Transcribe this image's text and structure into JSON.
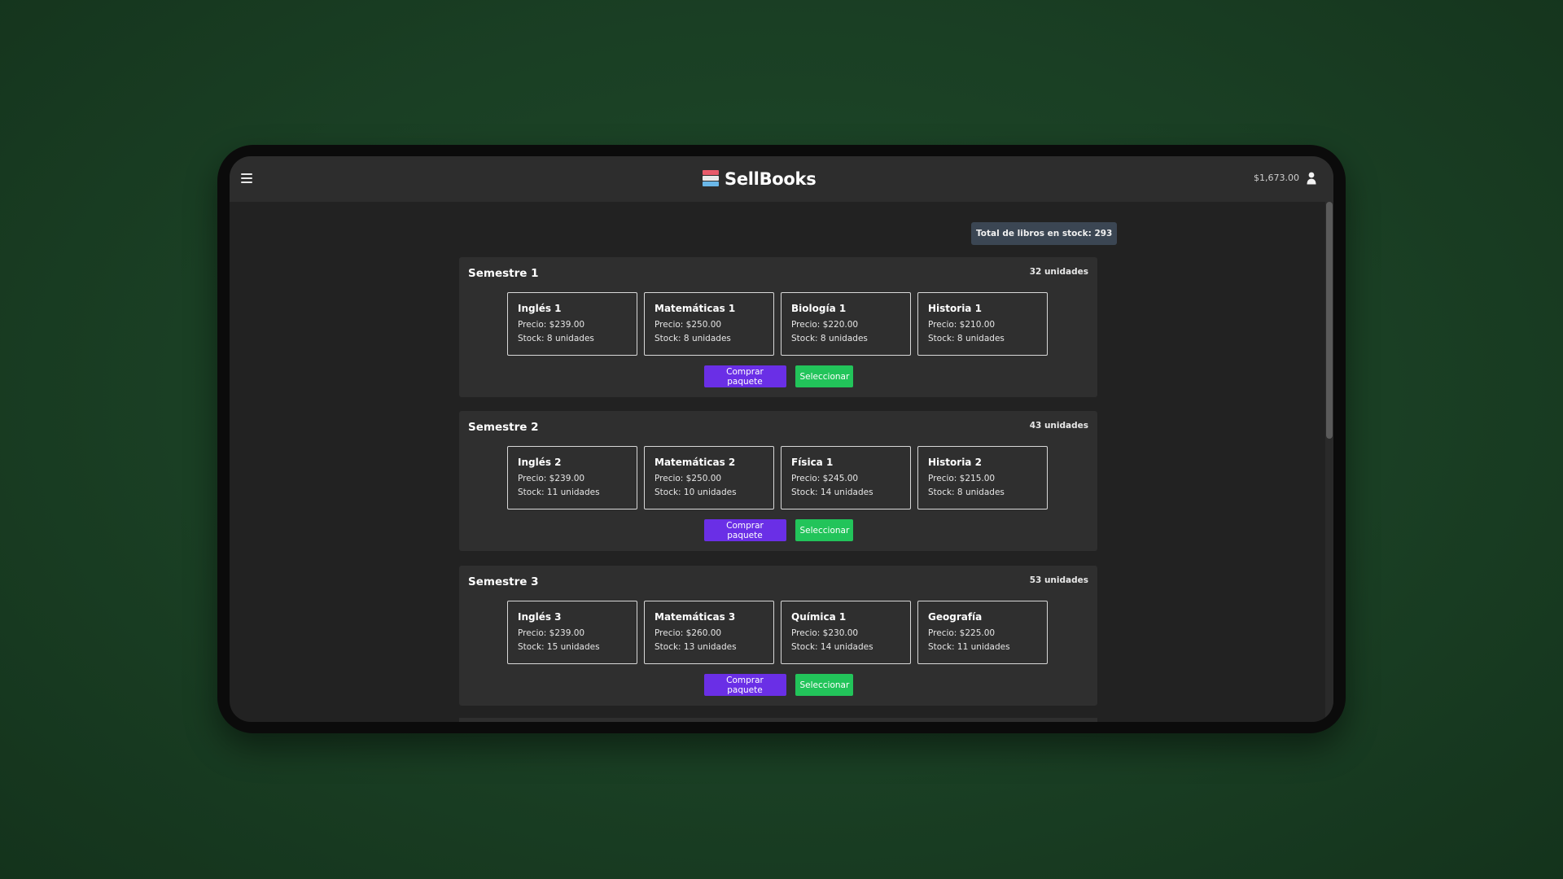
{
  "header": {
    "app_name": "SellBooks",
    "balance": "$1,673.00",
    "menu_icon": "hamburger-menu-icon",
    "logo_icon": "books-stack-icon",
    "user_icon": "user-icon"
  },
  "colors": {
    "background": "#1a3f24",
    "screen": "#222222",
    "topbar": "#2d2d2d",
    "card": "#2f2f2f",
    "badge": "#3b4653",
    "buy_button": "#6a2fe6",
    "select_button": "#22c45a"
  },
  "total_stock_label": "Total de libros en stock: 293",
  "semesters": [
    {
      "title": "Semestre 1",
      "units": "32 unidades",
      "books": [
        {
          "title": "Inglés 1",
          "price": "Precio: $239.00",
          "stock": "Stock: 8 unidades"
        },
        {
          "title": "Matemáticas 1",
          "price": "Precio: $250.00",
          "stock": "Stock: 8 unidades"
        },
        {
          "title": "Biología 1",
          "price": "Precio: $220.00",
          "stock": "Stock: 8 unidades"
        },
        {
          "title": "Historia 1",
          "price": "Precio: $210.00",
          "stock": "Stock: 8 unidades"
        }
      ],
      "buy_label": "Comprar paquete",
      "select_label": "Seleccionar"
    },
    {
      "title": "Semestre 2",
      "units": "43 unidades",
      "books": [
        {
          "title": "Inglés 2",
          "price": "Precio: $239.00",
          "stock": "Stock: 11 unidades"
        },
        {
          "title": "Matemáticas 2",
          "price": "Precio: $250.00",
          "stock": "Stock: 10 unidades"
        },
        {
          "title": "Física 1",
          "price": "Precio: $245.00",
          "stock": "Stock: 14 unidades"
        },
        {
          "title": "Historia 2",
          "price": "Precio: $215.00",
          "stock": "Stock: 8 unidades"
        }
      ],
      "buy_label": "Comprar paquete",
      "select_label": "Seleccionar"
    },
    {
      "title": "Semestre 3",
      "units": "53 unidades",
      "books": [
        {
          "title": "Inglés 3",
          "price": "Precio: $239.00",
          "stock": "Stock: 15 unidades"
        },
        {
          "title": "Matemáticas 3",
          "price": "Precio: $260.00",
          "stock": "Stock: 13 unidades"
        },
        {
          "title": "Química 1",
          "price": "Precio: $230.00",
          "stock": "Stock: 14 unidades"
        },
        {
          "title": "Geografía",
          "price": "Precio: $225.00",
          "stock": "Stock: 11 unidades"
        }
      ],
      "buy_label": "Comprar paquete",
      "select_label": "Seleccionar"
    }
  ]
}
